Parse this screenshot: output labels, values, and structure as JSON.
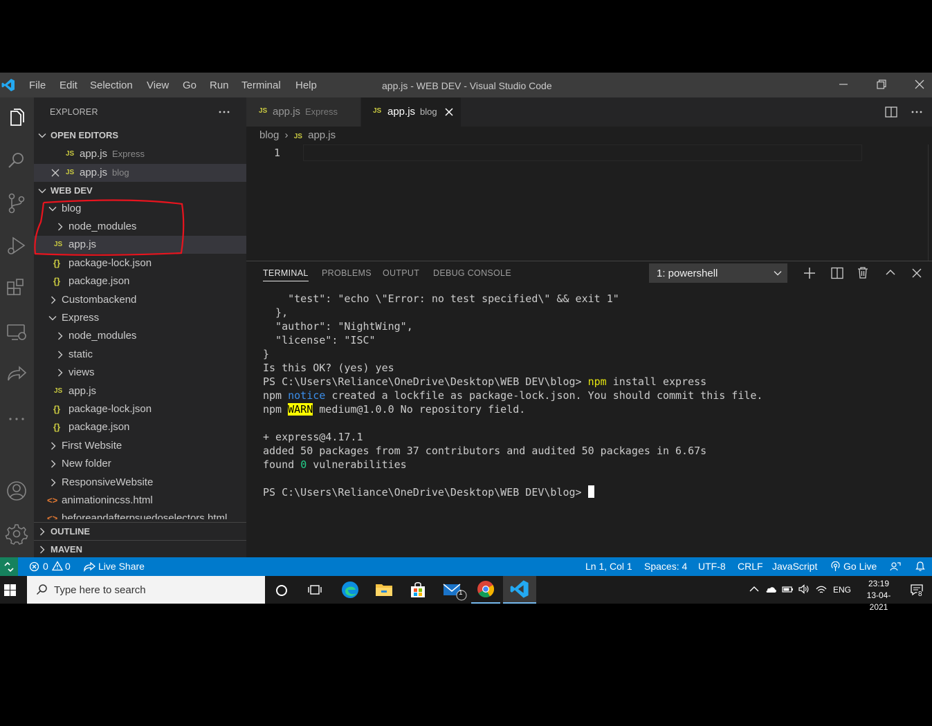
{
  "window": {
    "title": "app.js - WEB DEV - Visual Studio Code",
    "menu": [
      "File",
      "Edit",
      "Selection",
      "View",
      "Go",
      "Run",
      "Terminal",
      "Help"
    ]
  },
  "sidebar": {
    "explorer_title": "EXPLORER",
    "open_editors_label": "OPEN EDITORS",
    "open_editors": [
      {
        "name": "app.js",
        "desc": "Express"
      },
      {
        "name": "app.js",
        "desc": "blog"
      }
    ],
    "workspace_label": "WEB DEV",
    "tree": [
      {
        "name": "blog",
        "type": "folder-open"
      },
      {
        "name": "node_modules",
        "type": "folder"
      },
      {
        "name": "app.js",
        "type": "js"
      },
      {
        "name": "package-lock.json",
        "type": "json"
      },
      {
        "name": "package.json",
        "type": "json"
      },
      {
        "name": "Custombackend",
        "type": "folder"
      },
      {
        "name": "Express",
        "type": "folder-open"
      },
      {
        "name": "node_modules",
        "type": "folder"
      },
      {
        "name": "static",
        "type": "folder"
      },
      {
        "name": "views",
        "type": "folder"
      },
      {
        "name": "app.js",
        "type": "js"
      },
      {
        "name": "package-lock.json",
        "type": "json"
      },
      {
        "name": "package.json",
        "type": "json"
      },
      {
        "name": "First Website",
        "type": "folder"
      },
      {
        "name": "New folder",
        "type": "folder"
      },
      {
        "name": "ResponsiveWebsite",
        "type": "folder"
      },
      {
        "name": "animationincss.html",
        "type": "html"
      },
      {
        "name": "beforeandafterpsuedoselectors.html",
        "type": "html"
      }
    ],
    "outline_label": "OUTLINE",
    "maven_label": "MAVEN"
  },
  "editor": {
    "tabs": [
      {
        "name": "app.js",
        "desc": "Express"
      },
      {
        "name": "app.js",
        "desc": "blog"
      }
    ],
    "breadcrumb": [
      "blog",
      "app.js"
    ],
    "line_number": "1"
  },
  "panel": {
    "tabs": [
      "TERMINAL",
      "PROBLEMS",
      "OUTPUT",
      "DEBUG CONSOLE"
    ],
    "terminal_select": "1: powershell",
    "lines": [
      "    \"test\": \"echo \\\"Error: no test specified\\\" && exit 1\"",
      "  },",
      "  \"author\": \"NightWing\",",
      "  \"license\": \"ISC\"",
      "}",
      "",
      "",
      "Is this OK? (yes) yes"
    ],
    "prompt": "PS C:\\Users\\Reliance\\OneDrive\\Desktop\\WEB DEV\\blog> ",
    "cmd_npm": "npm",
    "cmd_rest": " install express",
    "notice_prefix": "npm ",
    "notice_word": "notice",
    "notice_rest": " created a lockfile as package-lock.json. You should commit this file.",
    "warn_prefix": "npm ",
    "warn_word": "WARN",
    "warn_rest": " medium@1.0.0 No repository field.",
    "result_lines": [
      "+ express@4.17.1",
      "added 50 packages from 37 contributors and audited 50 packages in 6.67s"
    ],
    "found_prefix": "found ",
    "found_count": "0",
    "found_rest": " vulnerabilities",
    "final_prompt": "PS C:\\Users\\Reliance\\OneDrive\\Desktop\\WEB DEV\\blog> "
  },
  "statusbar": {
    "errors": "0",
    "warnings": "0",
    "live_share": "Live Share",
    "position": "Ln 1, Col 1",
    "spaces": "Spaces: 4",
    "encoding": "UTF-8",
    "eol": "CRLF",
    "language": "JavaScript",
    "go_live": "Go Live"
  },
  "taskbar": {
    "search_placeholder": "Type here to search",
    "lang": "ENG",
    "time": "23:19",
    "date": "13-04-2021",
    "mail_badge": "1",
    "notif_badge": "8"
  },
  "colors": {
    "accent": "#007acc",
    "js_icon": "#cbcb41",
    "annotation": "#e8141e",
    "warn_bg": "#ffff00",
    "notice": "#3b8eea"
  }
}
